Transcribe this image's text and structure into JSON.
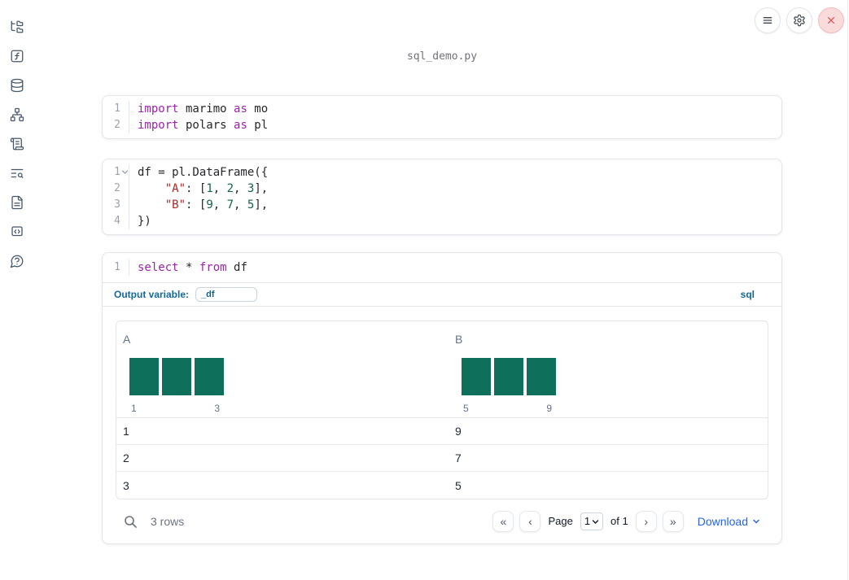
{
  "window": {
    "title": "sql_demo.py"
  },
  "topbar": {
    "buttons": [
      {
        "icon": "menu-icon"
      },
      {
        "icon": "gear-icon"
      },
      {
        "icon": "close-icon"
      }
    ]
  },
  "sidebar": {
    "items": [
      {
        "icon": "file-tree-icon"
      },
      {
        "icon": "function-square-icon"
      },
      {
        "icon": "database-icon"
      },
      {
        "icon": "dependency-graph-icon"
      },
      {
        "icon": "scroll-icon"
      },
      {
        "icon": "list-search-icon"
      },
      {
        "icon": "document-icon"
      },
      {
        "icon": "code-snippet-icon"
      },
      {
        "icon": "help-circle-icon"
      }
    ]
  },
  "colors": {
    "keyword": "#9d22ad",
    "string": "#b02525",
    "number": "#116644",
    "histogram_bar": "#0e6f5b",
    "accent_blue": "#13699c",
    "link_blue": "#2563eb"
  },
  "cells": [
    {
      "lines": [
        {
          "n": "1",
          "tokens": [
            [
              "kw",
              "import"
            ],
            [
              "pl",
              " marimo "
            ],
            [
              "kw",
              "as"
            ],
            [
              "pl",
              " mo"
            ]
          ]
        },
        {
          "n": "2",
          "tokens": [
            [
              "kw",
              "import"
            ],
            [
              "pl",
              " polars "
            ],
            [
              "kw",
              "as"
            ],
            [
              "pl",
              " pl"
            ]
          ]
        }
      ]
    },
    {
      "lines": [
        {
          "n": "1",
          "fold": true,
          "tokens": [
            [
              "pl",
              "df = pl.DataFrame({"
            ]
          ]
        },
        {
          "n": "2",
          "tokens": [
            [
              "pl",
              "    "
            ],
            [
              "str",
              "\"A\""
            ],
            [
              "pl",
              ": ["
            ],
            [
              "num",
              "1"
            ],
            [
              "pl",
              ", "
            ],
            [
              "num",
              "2"
            ],
            [
              "pl",
              ", "
            ],
            [
              "num",
              "3"
            ],
            [
              "pl",
              "],"
            ]
          ]
        },
        {
          "n": "3",
          "tokens": [
            [
              "pl",
              "    "
            ],
            [
              "str",
              "\"B\""
            ],
            [
              "pl",
              ": ["
            ],
            [
              "num",
              "9"
            ],
            [
              "pl",
              ", "
            ],
            [
              "num",
              "7"
            ],
            [
              "pl",
              ", "
            ],
            [
              "num",
              "5"
            ],
            [
              "pl",
              "],"
            ]
          ]
        },
        {
          "n": "4",
          "tokens": [
            [
              "pl",
              "})"
            ]
          ]
        }
      ]
    },
    {
      "lines": [
        {
          "n": "1",
          "tokens": [
            [
              "kw",
              "select"
            ],
            [
              "pl",
              " * "
            ],
            [
              "kw",
              "from"
            ],
            [
              "pl",
              " df"
            ]
          ]
        }
      ]
    }
  ],
  "sql_cell": {
    "output_variable_label": "Output variable:",
    "output_variable_value": "_df",
    "language_badge": "sql"
  },
  "table": {
    "columns": [
      {
        "name": "A",
        "hist": {
          "bars": [
            1,
            1,
            1
          ],
          "min_label": "1",
          "max_label": "3"
        }
      },
      {
        "name": "B",
        "hist": {
          "bars": [
            1,
            1,
            1
          ],
          "min_label": "5",
          "max_label": "9"
        }
      }
    ],
    "rows": [
      [
        "1",
        "9"
      ],
      [
        "2",
        "7"
      ],
      [
        "3",
        "5"
      ]
    ],
    "footer": {
      "row_count": "3 rows",
      "pager": {
        "first": "«",
        "prev": "‹",
        "next": "›",
        "last": "»"
      },
      "page_label": "Page",
      "page_value": "1",
      "of_label": "of 1",
      "download_label": "Download"
    }
  }
}
